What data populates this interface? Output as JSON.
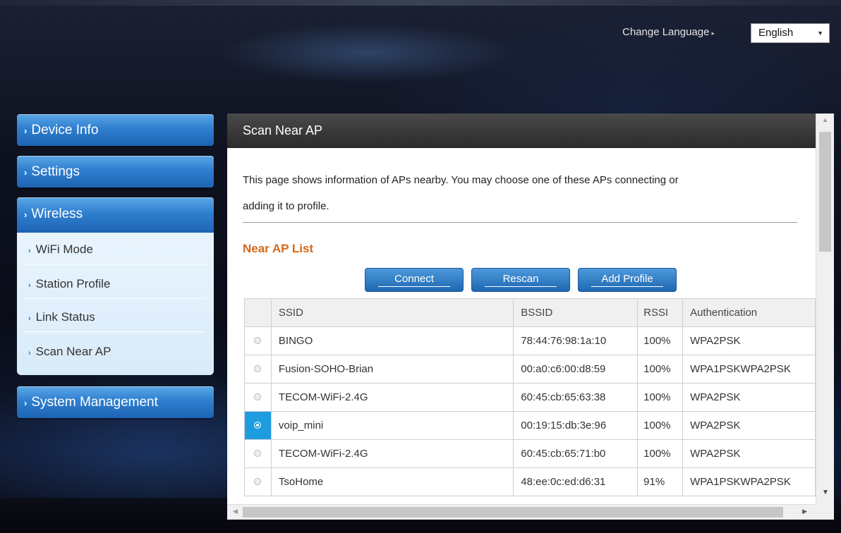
{
  "header": {
    "change_language_label": "Change Language",
    "language_selected": "English"
  },
  "sidebar": {
    "items": [
      {
        "label": "Device Info"
      },
      {
        "label": "Settings"
      },
      {
        "label": "Wireless"
      },
      {
        "label": "System Management"
      }
    ],
    "wireless_submenu": [
      {
        "label": "WiFi Mode"
      },
      {
        "label": "Station Profile"
      },
      {
        "label": "Link Status"
      },
      {
        "label": "Scan Near AP"
      }
    ]
  },
  "main": {
    "title": "Scan Near AP",
    "description_line1": "This page shows information of APs nearby. You may choose one of these APs connecting or",
    "description_line2": "adding it to profile.",
    "list_title": "Near AP List",
    "buttons": {
      "connect": "Connect",
      "rescan": "Rescan",
      "add_profile": "Add Profile"
    },
    "table": {
      "columns": [
        "SSID",
        "BSSID",
        "RSSI",
        "Authentication"
      ],
      "rows": [
        {
          "ssid": "BINGO",
          "bssid": "78:44:76:98:1a:10",
          "rssi": "100%",
          "auth": "WPA2PSK",
          "selected": false
        },
        {
          "ssid": "Fusion-SOHO-Brian",
          "bssid": "00:a0:c6:00:d8:59",
          "rssi": "100%",
          "auth": "WPA1PSKWPA2PSK",
          "selected": false
        },
        {
          "ssid": "TECOM-WiFi-2.4G",
          "bssid": "60:45:cb:65:63:38",
          "rssi": "100%",
          "auth": "WPA2PSK",
          "selected": false
        },
        {
          "ssid": "voip_mini",
          "bssid": "00:19:15:db:3e:96",
          "rssi": "100%",
          "auth": "WPA2PSK",
          "selected": true
        },
        {
          "ssid": "TECOM-WiFi-2.4G",
          "bssid": "60:45:cb:65:71:b0",
          "rssi": "100%",
          "auth": "WPA2PSK",
          "selected": false
        },
        {
          "ssid": "TsoHome",
          "bssid": "48:ee:0c:ed:d6:31",
          "rssi": "91%",
          "auth": "WPA1PSKWPA2PSK",
          "selected": false
        }
      ]
    }
  },
  "colors": {
    "menu_blue": "#2f7fcf",
    "list_title_orange": "#d36a1a",
    "selected_row_blue": "#1e9ce0"
  }
}
